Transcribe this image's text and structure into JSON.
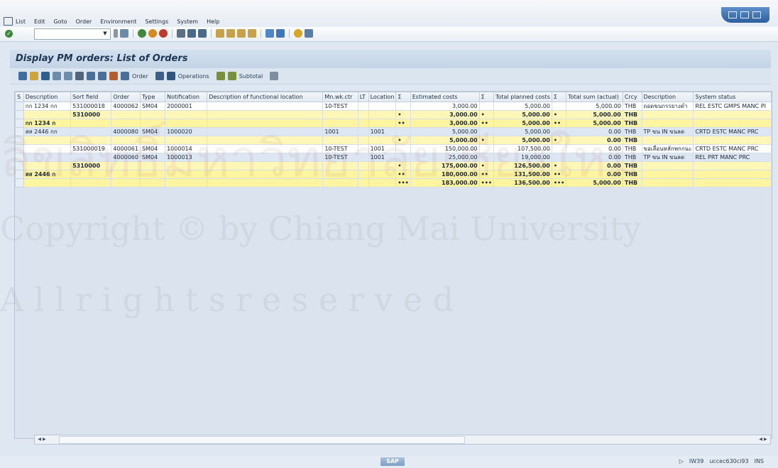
{
  "menu": {
    "items": [
      "List",
      "Edit",
      "Goto",
      "Order",
      "Environment",
      "Settings",
      "System",
      "Help"
    ]
  },
  "title": "Display PM orders: List of Orders",
  "app_toolbar": {
    "order_label": "Order",
    "operations_label": "Operations",
    "subtotal_label": "Subtotal"
  },
  "table": {
    "columns": [
      "S",
      "Description",
      "Sort field",
      "Order",
      "Type",
      "Notification",
      "Description of functional location",
      "Mn.wk.ctr",
      "LT",
      "Location",
      "Σ",
      "Estimated costs",
      "Σ",
      "Total planned costs",
      "Σ",
      "Total sum (actual)",
      "Crcy",
      "Description",
      "System status"
    ],
    "rows": [
      {
        "kind": "white",
        "cells": [
          "",
          "กก 1234 กก",
          "531000018",
          "4000062",
          "SM04",
          "2000001",
          "",
          "10-TEST",
          "",
          "",
          "",
          "3,000.00",
          "",
          "5,000.00",
          "",
          "5,000.00",
          "THB",
          "ถอดขนกรรยางดำ",
          "REL  ESTC GMPS MANC PI"
        ]
      },
      {
        "kind": "yellow",
        "cells": [
          "",
          "",
          "5310000",
          "",
          "",
          "",
          "",
          "",
          "",
          "",
          "•",
          "3,000.00",
          "•",
          "5,000.00",
          "•",
          "5,000.00",
          "THB",
          "",
          ""
        ]
      },
      {
        "kind": "yellow2",
        "cells": [
          "",
          "กก 1234 ก",
          "",
          "",
          "",
          "",
          "",
          "",
          "",
          "",
          "••",
          "3,000.00",
          "••",
          "5,000.00",
          "••",
          "5,000.00",
          "THB",
          "",
          ""
        ]
      },
      {
        "kind": "blue",
        "cells": [
          "",
          "สส 2446 กก",
          "",
          "4000080",
          "SM04",
          "1000020",
          "",
          "1001",
          "",
          "1001",
          "",
          "5,000.00",
          "",
          "5,000.00",
          "",
          "0.00",
          "THB",
          "TP ขน IN ขนลด",
          "CRTD ESTC MANC PRC"
        ]
      },
      {
        "kind": "yellow",
        "cells": [
          "",
          "",
          "",
          "",
          "",
          "",
          "",
          "",
          "",
          "",
          "•",
          "5,000.00",
          "•",
          "5,000.00",
          "•",
          "0.00",
          "THB",
          "",
          ""
        ]
      },
      {
        "kind": "white",
        "cells": [
          "",
          "",
          "531000019",
          "4000061",
          "SM04",
          "1000014",
          "",
          "10-TEST",
          "",
          "1001",
          "",
          "150,000.00",
          "",
          "107,500.00",
          "",
          "0.00",
          "THB",
          "ขอเลื่อนหลักพกกนะ",
          "CRTD ESTC MANC PRC"
        ]
      },
      {
        "kind": "blue",
        "cells": [
          "",
          "",
          "",
          "4000060",
          "SM04",
          "1000013",
          "",
          "10-TEST",
          "",
          "1001",
          "",
          "25,000.00",
          "",
          "19,000.00",
          "",
          "0.00",
          "THB",
          "TP ขน IN ขนลด",
          "REL  PRT  MANC PRC"
        ]
      },
      {
        "kind": "yellow",
        "cells": [
          "",
          "",
          "5310000",
          "",
          "",
          "",
          "",
          "",
          "",
          "",
          "•",
          "175,000.00",
          "•",
          "126,500.00",
          "•",
          "0.00",
          "THB",
          "",
          ""
        ]
      },
      {
        "kind": "yellow2",
        "cells": [
          "",
          "สส 2446 ก",
          "",
          "",
          "",
          "",
          "",
          "",
          "",
          "",
          "••",
          "180,000.00",
          "••",
          "131,500.00",
          "••",
          "0.00",
          "THB",
          "",
          ""
        ]
      },
      {
        "kind": "yellow2",
        "cells": [
          "",
          "",
          "",
          "",
          "",
          "",
          "",
          "",
          "",
          "",
          "•••",
          "183,000.00",
          "•••",
          "136,500.00",
          "•••",
          "5,000.00",
          "THB",
          "",
          ""
        ]
      }
    ]
  },
  "status_bar": {
    "logo": "SAP",
    "transaction": "IW39",
    "server": "uccec630ci93",
    "mode": "INS"
  },
  "watermark": {
    "line1": "Copyright © by Chiang Mai University",
    "line2": "A l l   r i g h t s   r e s e r v e d",
    "thai": "ลิขสิทธิ์มหาวิทยาลัยเชียงใหม่"
  }
}
